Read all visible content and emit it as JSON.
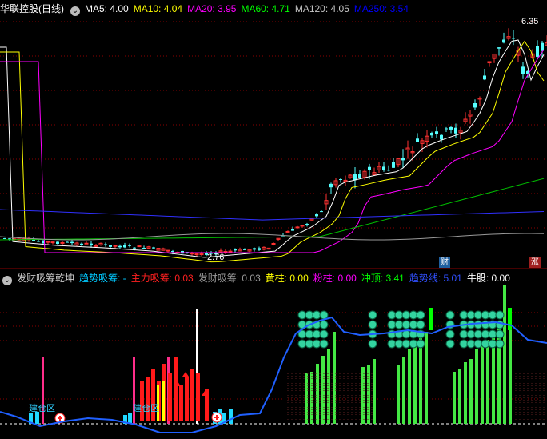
{
  "main_header": {
    "stock_name": "华联控股(日线)",
    "ma_items": [
      {
        "label": "MA5: 4.00",
        "color": "#ffffff"
      },
      {
        "label": "MA10: 4.04",
        "color": "#ffff00"
      },
      {
        "label": "MA20: 3.95",
        "color": "#ff00ff"
      },
      {
        "label": "MA60: 4.71",
        "color": "#00ff00"
      },
      {
        "label": "MA120: 4.05",
        "color": "#c8c8c8"
      },
      {
        "label": "MA250: 3.54",
        "color": "#0000ff"
      }
    ]
  },
  "main_chart": {
    "high_label": "6.35",
    "low_label": "2.76",
    "finance_badge": "财",
    "limit_badge": "涨"
  },
  "indicator_header": {
    "title": "发财吸筹乾坤",
    "items": [
      {
        "label": "趋势吸筹: -",
        "color": "#00c8ff"
      },
      {
        "label": "主力吸筹: 0.03",
        "color": "#ff2020"
      },
      {
        "label": "发财吸筹: 0.03",
        "color": "#9a9a9a"
      },
      {
        "label": "黄柱: 0.00",
        "color": "#ffff00"
      },
      {
        "label": "粉柱: 0.00",
        "color": "#ff00ff"
      },
      {
        "label": "冲顶: 3.41",
        "color": "#00ff00"
      },
      {
        "label": "趋势线: 5.01",
        "color": "#3050ff"
      },
      {
        "label": "牛股: 0.00",
        "color": "#ffffff"
      }
    ]
  },
  "indicator_chart": {
    "zone_labels": [
      "建仓区",
      "建仓区"
    ]
  },
  "colors": {
    "up": "#ff3232",
    "down": "#54ffff",
    "grid": "#8b0000",
    "background": "#000000"
  }
}
